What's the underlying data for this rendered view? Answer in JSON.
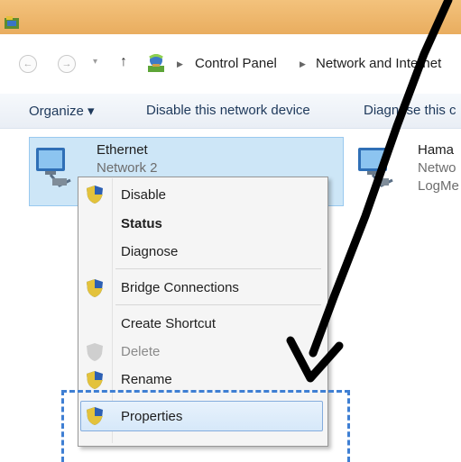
{
  "address": {
    "crumbs": [
      "Control Panel",
      "Network and Internet"
    ]
  },
  "toolbar": {
    "organize": "Organize ▾",
    "disable_device": "Disable this network device",
    "diagnose": "Diagnose this c"
  },
  "adapters": [
    {
      "name": "Ethernet",
      "network": "Network 2",
      "selected": true
    },
    {
      "name": "Hama",
      "network": "Netwo",
      "extra": "LogMe",
      "selected": false
    }
  ],
  "context_menu": {
    "items": [
      {
        "label": "Disable",
        "shield": true,
        "bold": false,
        "disabled": false
      },
      {
        "label": "Status",
        "shield": false,
        "bold": true,
        "disabled": false
      },
      {
        "label": "Diagnose",
        "shield": false,
        "bold": false,
        "disabled": false
      },
      {
        "label": "Bridge Connections",
        "shield": true,
        "bold": false,
        "disabled": false
      },
      {
        "label": "Create Shortcut",
        "shield": false,
        "bold": false,
        "disabled": false
      },
      {
        "label": "Delete",
        "shield": true,
        "bold": false,
        "disabled": true
      },
      {
        "label": "Rename",
        "shield": true,
        "bold": false,
        "disabled": false
      },
      {
        "label": "Properties",
        "shield": true,
        "bold": false,
        "disabled": false,
        "highlighted": true
      }
    ]
  },
  "colors": {
    "title_bar": "#eab467",
    "selection": "#cde6f7",
    "highlight_border": "#84acdd",
    "annotation_dash": "#3f7fd3",
    "arrow": "#000000"
  }
}
